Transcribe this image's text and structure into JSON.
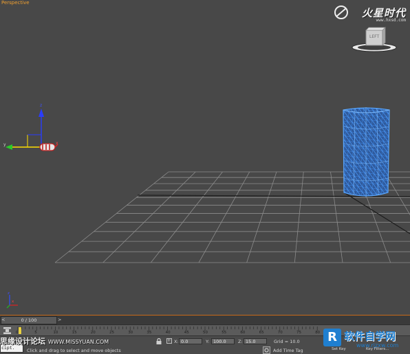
{
  "viewport": {
    "label": "Perspective"
  },
  "watermark_top": {
    "brand": "火星时代",
    "url": "www.hxsd.com"
  },
  "viewcube": {
    "face_label": "LEFT"
  },
  "gizmo": {
    "axis_z": "z",
    "axis_y": "y",
    "axis_x": "x"
  },
  "small_gizmo": {
    "axis_z": "z",
    "axis_x": "x"
  },
  "timeline": {
    "slider_text": "0 / 100",
    "ticks": [
      "0",
      "5",
      "10",
      "15",
      "20",
      "25",
      "30",
      "35",
      "40",
      "45",
      "50",
      "55",
      "60",
      "65",
      "70",
      "75",
      "80"
    ]
  },
  "status_bar": {
    "x_label": "X:",
    "x_value": "0.0",
    "y_label": "Y:",
    "y_value": "100.0",
    "z_label": "Z:",
    "z_value": "15.0",
    "grid_text": "Grid = 10.0",
    "prompt": "Click and drag to select and move objects",
    "add_time_tag": "Add Time Tag",
    "set_key": "Set Key",
    "key_filters": "Key Filters...",
    "script_text": "cipt."
  },
  "watermark_bottom_left": {
    "text": "思缘设计论坛",
    "url": "WWW.MISSYUAN.COM"
  },
  "watermark_bottom_right": {
    "badge": "R",
    "text": "软件自学网",
    "url": "www.rjzxw.com"
  },
  "colors": {
    "viewport_bg": "#484848",
    "grid_line": "#8a8a8a",
    "mesh_blue": "#3d8cf0",
    "label_orange": "#f0a030",
    "timeline_accent": "#c86a1a"
  }
}
